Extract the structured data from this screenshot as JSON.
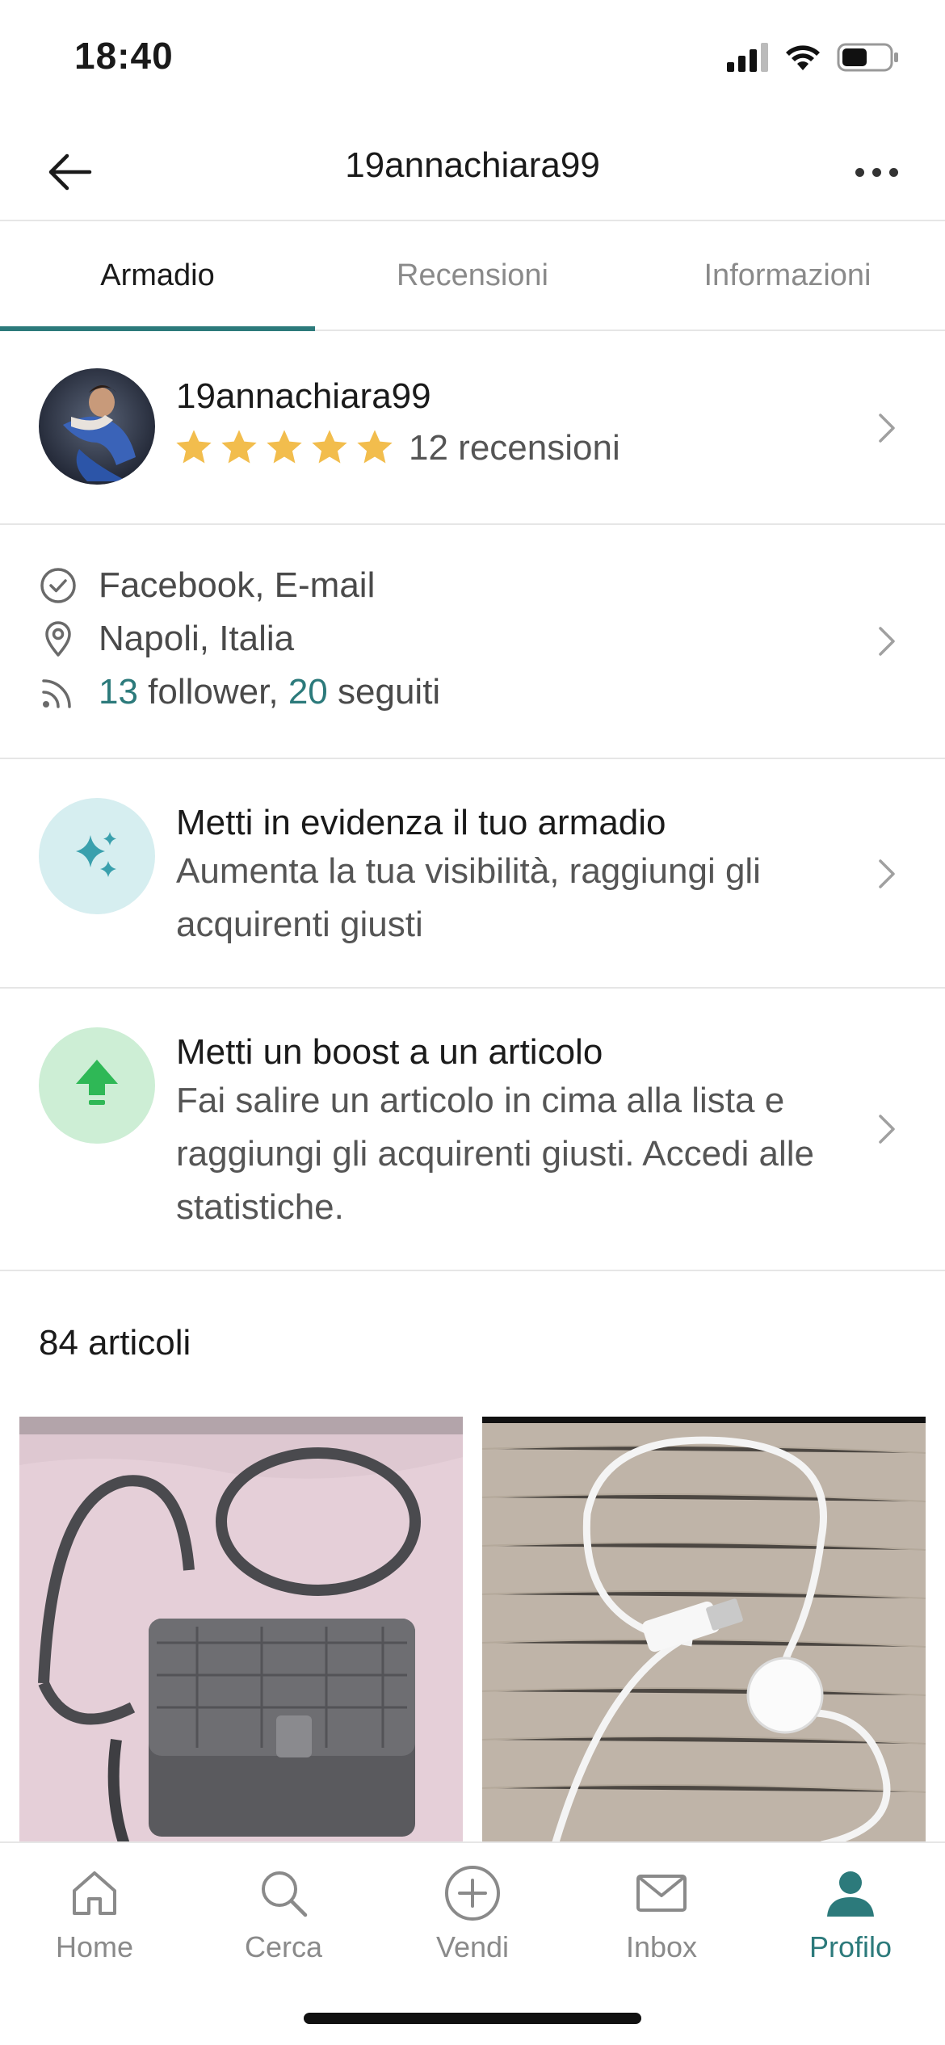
{
  "status_bar": {
    "time": "18:40"
  },
  "header": {
    "title": "19annachiara99"
  },
  "tabs": [
    {
      "label": "Armadio",
      "active": true
    },
    {
      "label": "Recensioni",
      "active": false
    },
    {
      "label": "Informazioni",
      "active": false
    }
  ],
  "profile": {
    "username": "19annachiara99",
    "rating_stars": 5,
    "reviews_label": "12 recensioni"
  },
  "info": {
    "verified": "Facebook, E-mail",
    "location": "Napoli, Italia",
    "followers_count": "13",
    "followers_label": " follower, ",
    "following_count": "20",
    "following_label": " seguiti"
  },
  "promo_wardrobe": {
    "title": "Metti in evidenza il tuo armadio",
    "text": "Aumenta la tua visibilità, raggiungi gli acquirenti giusti"
  },
  "promo_boost": {
    "title": "Metti un boost a un articolo",
    "text": "Fai salire un articolo in cima alla lista e raggiungi gli acquirenti giusti. Accedi alle statistiche."
  },
  "items": {
    "count_label": "84 articoli"
  },
  "tabbar": [
    {
      "label": "Home",
      "icon": "home-icon",
      "active": false
    },
    {
      "label": "Cerca",
      "icon": "search-icon",
      "active": false
    },
    {
      "label": "Vendi",
      "icon": "plus-circle-icon",
      "active": false
    },
    {
      "label": "Inbox",
      "icon": "mail-icon",
      "active": false
    },
    {
      "label": "Profilo",
      "icon": "user-icon",
      "active": true
    }
  ],
  "colors": {
    "accent": "#2c7a7b",
    "star": "#f2bd4d",
    "promo_blue_bg": "#d6eef0",
    "promo_green_bg": "#cdeed5"
  }
}
